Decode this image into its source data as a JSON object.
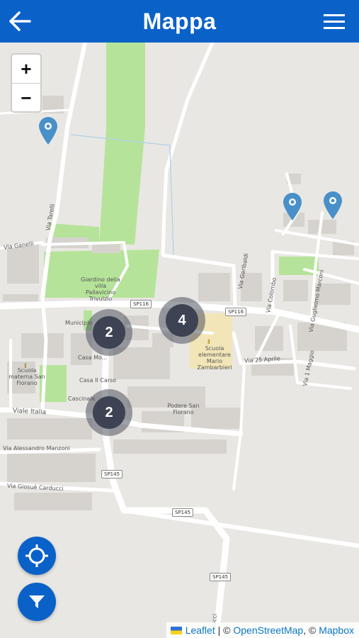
{
  "header": {
    "title": "Mappa",
    "back_icon": "arrow-left-icon",
    "menu_icon": "hamburger-menu-icon",
    "color": "#0a62c9"
  },
  "zoom": {
    "in_label": "+",
    "out_label": "−"
  },
  "clusters": [
    {
      "count": "2"
    },
    {
      "count": "4"
    },
    {
      "count": "2"
    }
  ],
  "markers": [
    {
      "icon": "map-pin-icon",
      "color": "#4a90c8"
    },
    {
      "icon": "map-pin-icon",
      "color": "#4a90c8"
    },
    {
      "icon": "map-pin-icon",
      "color": "#4a90c8"
    }
  ],
  "fabs": {
    "locate_icon": "crosshair-icon",
    "filter_icon": "filter-icon"
  },
  "map_labels": {
    "via_ganelli": "Via Ganelli",
    "via_tarelli": "Via Tarelli",
    "giardino": "Giardino della villa Pallavicino Trivulzio",
    "via_garibaldi": "Via Garibaldi",
    "via_colombo": "Via Colombo",
    "via_marconi": "Via Guglielmo Marconi",
    "municipio": "Municipio",
    "scuola_elementare": "Scuola elementare Mario Zambarbieri",
    "via_25_aprile": "Via 25 Aprile",
    "via_1_maggio": "Via 1 Maggio",
    "scuola_materna": "Scuola materna San Fiorano",
    "casa_mo": "Casa Mo...",
    "casa_carso": "Casa Il Carso",
    "cascinale": "Cascinale",
    "podere": "Podere San Fiorano",
    "viale_italia": "Viale Italia",
    "via_manzoni": "Via Alessandro Manzoni",
    "via_carducci": "Via Giosuè Carducci",
    "via_ducci": "ducci",
    "sp116_a": "SP116",
    "sp116_b": "SP116",
    "sp145_a": "SP145",
    "sp145_b": "SP145",
    "sp145_c": "SP145"
  },
  "attribution": {
    "leaflet": "Leaflet",
    "sep1": " | © ",
    "osm": "OpenStreetMap",
    "sep2": ", © ",
    "mapbox": "Mapbox"
  }
}
